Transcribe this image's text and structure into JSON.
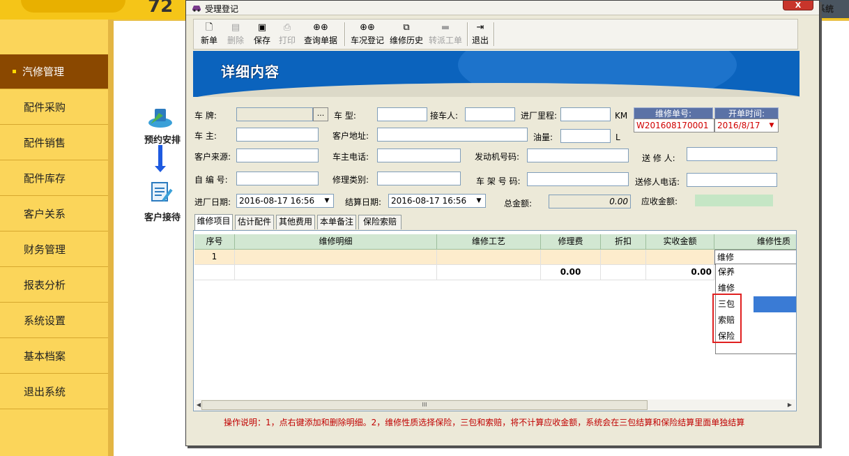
{
  "background_app": {
    "logo_text": "72",
    "system_label": "系统",
    "menu": [
      {
        "label": "汽修管理",
        "active": true
      },
      {
        "label": "配件采购",
        "active": false
      },
      {
        "label": "配件销售",
        "active": false
      },
      {
        "label": "配件库存",
        "active": false
      },
      {
        "label": "客户关系",
        "active": false
      },
      {
        "label": "财务管理",
        "active": false
      },
      {
        "label": "报表分析",
        "active": false
      },
      {
        "label": "系统设置",
        "active": false
      },
      {
        "label": "基本档案",
        "active": false
      },
      {
        "label": "退出系统",
        "active": false
      }
    ],
    "flow": {
      "step1": "预约安排",
      "step2": "客户接待"
    }
  },
  "dialog": {
    "title": "受理登记",
    "close_label": "X",
    "toolbar": {
      "new": "新单",
      "delete": "删除",
      "save": "保存",
      "print": "打印",
      "query": "查询单据",
      "car_register": "车况登记",
      "repair_history": "维修历史",
      "transfer": "转派工单",
      "exit": "退出"
    },
    "banner_title": "详细内容",
    "form": {
      "plate_label": "车    牌:",
      "plate_value": "",
      "plate_btn": "...",
      "model_label": "车    型:",
      "receiver_label": "接车人:",
      "mileage_label": "进厂里程:",
      "mileage_unit": "KM",
      "owner_label": "车    主:",
      "address_label": "客户地址:",
      "fuel_label": "油量:",
      "fuel_unit": "L",
      "source_label": "客户来源:",
      "owner_phone_label": "车主电话:",
      "engine_label": "发动机号码:",
      "sender_label": "送 修 人:",
      "custom_no_label": "自 编 号:",
      "repair_type_label": "修理类别:",
      "frame_label": "车 架 号 码:",
      "sender_phone_label": "送修人电话:",
      "entry_date_label": "进厂日期:",
      "entry_date_value": "2016-08-17 16:56",
      "settle_date_label": "结算日期:",
      "settle_date_value": "2016-08-17 16:56",
      "total_label": "总金额:",
      "total_value": "0.00",
      "receivable_label": "应收金额:",
      "order_no_label": "维修单号:",
      "order_no_value": "W201608170001",
      "open_time_label": "开单时间:",
      "open_time_value": "2016/8/17"
    },
    "tabs": [
      "维修项目",
      "估计配件",
      "其他费用",
      "本单备注",
      "保险索赔"
    ],
    "grid": {
      "columns": [
        "序号",
        "维修明细",
        "维修工艺",
        "修理费",
        "折扣",
        "实收金额",
        "维修性质"
      ],
      "row1": {
        "no": "1",
        "nature": "维修"
      },
      "totals": {
        "fee": "0.00",
        "amount": "0.00"
      }
    },
    "dropdown_options": [
      "保养",
      "维修",
      "三包",
      "索赔",
      "保险"
    ],
    "dropdown_highlighted": "三包",
    "scroll_thumb": "III",
    "note": "操作说明：1，点右键添加和删除明细。2，维修性质选择保险，三包和索赔，将不计算应收金额，系统会在三包结算和保险结算里面单独结算"
  },
  "colors": {
    "accent_yellow": "#fbd55a",
    "menu_active": "#8a4800",
    "banner_blue": "#0b63bd",
    "grid_header": "#d2e7d2",
    "note_red": "#c00000",
    "highlight_blue": "#3a7bd5"
  }
}
